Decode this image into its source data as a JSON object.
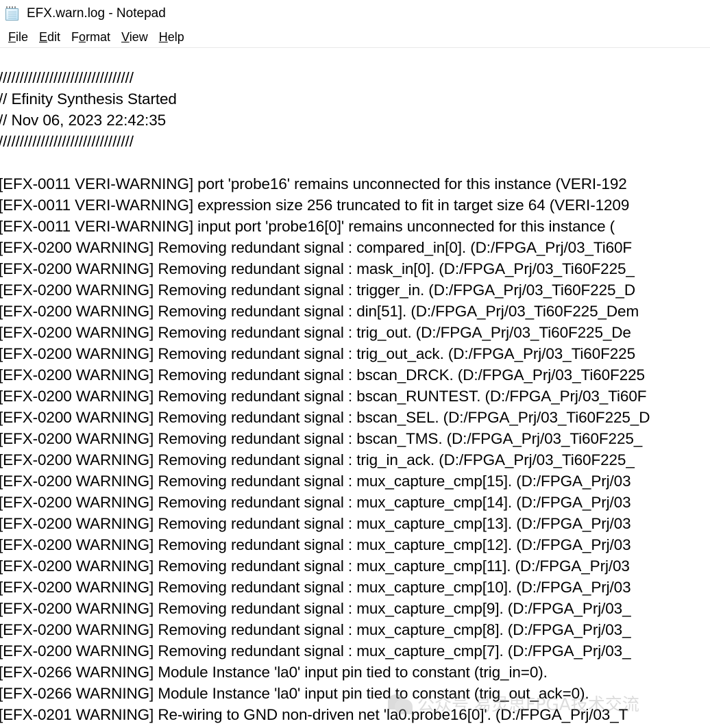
{
  "window": {
    "title": "EFX.warn.log - Notepad",
    "icon": "notepad-icon"
  },
  "menu": {
    "items": [
      {
        "label": "File",
        "accel": "F",
        "rest": "ile"
      },
      {
        "label": "Edit",
        "accel": "E",
        "rest": "dit"
      },
      {
        "label": "Format",
        "accel": "o",
        "pre": "F",
        "rest": "rmat"
      },
      {
        "label": "View",
        "accel": "V",
        "rest": "iew"
      },
      {
        "label": "Help",
        "accel": "H",
        "rest": "elp"
      }
    ]
  },
  "document": {
    "lines": [
      "////////////////////////////////",
      "// Efinity Synthesis Started",
      "// Nov 06, 2023 22:42:35",
      "////////////////////////////////",
      "",
      "[EFX-0011 VERI-WARNING] port 'probe16' remains unconnected for this instance (VERI-192",
      "[EFX-0011 VERI-WARNING] expression size 256 truncated to fit in target size 64 (VERI-1209",
      "[EFX-0011 VERI-WARNING] input port 'probe16[0]' remains unconnected for this instance (",
      "[EFX-0200 WARNING] Removing redundant signal : compared_in[0]. (D:/FPGA_Prj/03_Ti60F",
      "[EFX-0200 WARNING] Removing redundant signal : mask_in[0]. (D:/FPGA_Prj/03_Ti60F225_",
      "[EFX-0200 WARNING] Removing redundant signal : trigger_in. (D:/FPGA_Prj/03_Ti60F225_D",
      "[EFX-0200 WARNING] Removing redundant signal : din[51]. (D:/FPGA_Prj/03_Ti60F225_Dem",
      "[EFX-0200 WARNING] Removing redundant signal : trig_out. (D:/FPGA_Prj/03_Ti60F225_De",
      "[EFX-0200 WARNING] Removing redundant signal : trig_out_ack. (D:/FPGA_Prj/03_Ti60F225",
      "[EFX-0200 WARNING] Removing redundant signal : bscan_DRCK. (D:/FPGA_Prj/03_Ti60F225",
      "[EFX-0200 WARNING] Removing redundant signal : bscan_RUNTEST. (D:/FPGA_Prj/03_Ti60F",
      "[EFX-0200 WARNING] Removing redundant signal : bscan_SEL. (D:/FPGA_Prj/03_Ti60F225_D",
      "[EFX-0200 WARNING] Removing redundant signal : bscan_TMS. (D:/FPGA_Prj/03_Ti60F225_",
      "[EFX-0200 WARNING] Removing redundant signal : trig_in_ack. (D:/FPGA_Prj/03_Ti60F225_",
      "[EFX-0200 WARNING] Removing redundant signal : mux_capture_cmp[15]. (D:/FPGA_Prj/03",
      "[EFX-0200 WARNING] Removing redundant signal : mux_capture_cmp[14]. (D:/FPGA_Prj/03",
      "[EFX-0200 WARNING] Removing redundant signal : mux_capture_cmp[13]. (D:/FPGA_Prj/03",
      "[EFX-0200 WARNING] Removing redundant signal : mux_capture_cmp[12]. (D:/FPGA_Prj/03",
      "[EFX-0200 WARNING] Removing redundant signal : mux_capture_cmp[11]. (D:/FPGA_Prj/03",
      "[EFX-0200 WARNING] Removing redundant signal : mux_capture_cmp[10]. (D:/FPGA_Prj/03",
      "[EFX-0200 WARNING] Removing redundant signal : mux_capture_cmp[9]. (D:/FPGA_Prj/03_",
      "[EFX-0200 WARNING] Removing redundant signal : mux_capture_cmp[8]. (D:/FPGA_Prj/03_",
      "[EFX-0200 WARNING] Removing redundant signal : mux_capture_cmp[7]. (D:/FPGA_Prj/03_",
      "[EFX-0266 WARNING] Module Instance 'la0' input pin tied to constant (trig_in=0).",
      "[EFX-0266 WARNING] Module Instance 'la0' input pin tied to constant (trig_out_ack=0).",
      "[EFX-0201 WARNING] Re-wiring to GND non-driven net 'la0.probe16[0]'. (D:/FPGA_Prj/03_T"
    ]
  },
  "watermark": {
    "text": "公众号  易灵思FPGA技术交流",
    "icon": "speech-bubble-icon"
  },
  "colors": {
    "text": "#000000",
    "background": "#ffffff",
    "watermark": "#8e8e8e",
    "menu_divider": "#e8e8e8"
  }
}
